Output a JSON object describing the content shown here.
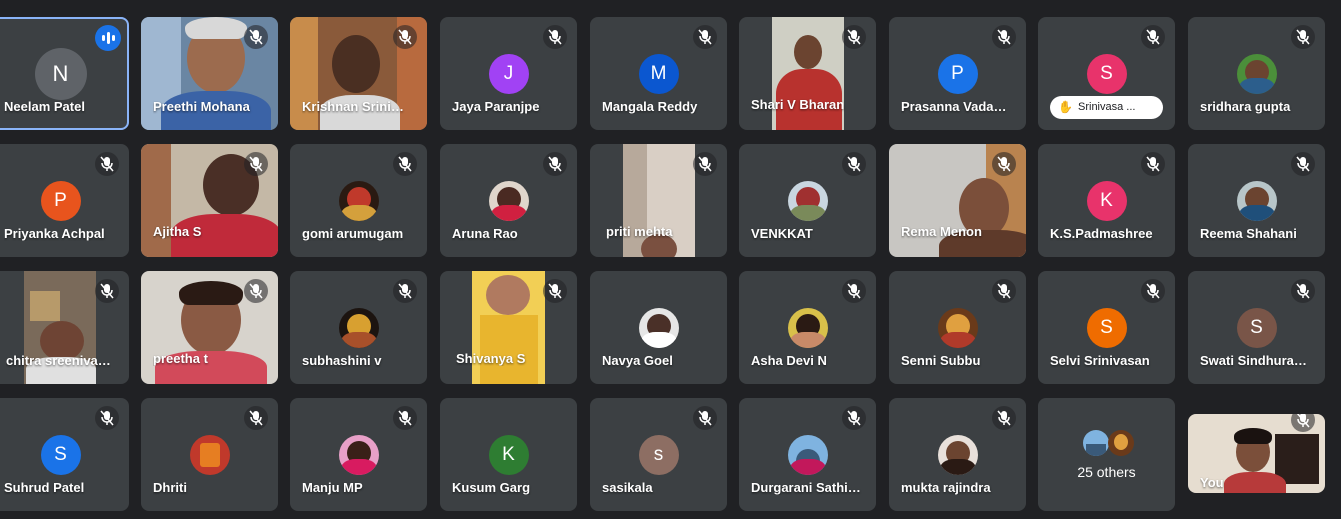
{
  "participants": [
    {
      "name": "Neelam Patel",
      "initial": "N",
      "speaking": true
    },
    {
      "name": "Preethi Mohana"
    },
    {
      "name": "Krishnan Srinivasan"
    },
    {
      "name": "Jaya Paranjpe",
      "initial": "J"
    },
    {
      "name": "Mangala Reddy",
      "initial": "M"
    },
    {
      "name": "Shari V Bharan"
    },
    {
      "name": "Prasanna Vadakkepat",
      "initial": "P"
    },
    {
      "name": "",
      "initial": "S",
      "hand_raised_label": "Srinivasa ..."
    },
    {
      "name": "sridhara gupta"
    },
    {
      "name": "Priyanka Achpal",
      "initial": "P"
    },
    {
      "name": "Ajitha S"
    },
    {
      "name": "gomi arumugam"
    },
    {
      "name": "Aruna Rao"
    },
    {
      "name": "priti mehta"
    },
    {
      "name": "VENKKAT"
    },
    {
      "name": "Rema Menon"
    },
    {
      "name": "K.S.Padmashree",
      "initial": "K"
    },
    {
      "name": "Reema Shahani"
    },
    {
      "name": "chitra sreenivasan"
    },
    {
      "name": "preetha t"
    },
    {
      "name": "subhashini v"
    },
    {
      "name": "Shivanya S"
    },
    {
      "name": "Navya Goel"
    },
    {
      "name": "Asha Devi N"
    },
    {
      "name": "Senni Subbu"
    },
    {
      "name": "Selvi Srinivasan",
      "initial": "S"
    },
    {
      "name": "Swati Sindhurakar",
      "initial": "S"
    },
    {
      "name": "Suhrud Patel",
      "initial": "S"
    },
    {
      "name": "Dhriti"
    },
    {
      "name": "Manju MP"
    },
    {
      "name": "Kusum Garg",
      "initial": "K"
    },
    {
      "name": "sasikala",
      "initial": "s"
    },
    {
      "name": "Durgarani Sathish"
    },
    {
      "name": "mukta rajindra"
    },
    {
      "name": "25 others"
    },
    {
      "name": "You"
    }
  ],
  "colors": {
    "background": "#202124",
    "tile": "#3c4043",
    "active_border": "#8ab4f8",
    "speaking_indicator": "#1a73e8",
    "avatar_N": "#5f6368",
    "avatar_J": "#a142f4",
    "avatar_M": "#0b57d0",
    "avatar_P_blue": "#1a73e8",
    "avatar_S_pink": "#e8336b",
    "avatar_P_orange": "#e8541d",
    "avatar_K_pink": "#e8336b",
    "avatar_S_orange": "#ef6c00",
    "avatar_S_brown": "#795548",
    "avatar_S_blue": "#1a73e8",
    "avatar_K_green": "#2e7d32",
    "avatar_s_brown": "#8d6e63"
  },
  "icons": {
    "muted": "mic-off-icon",
    "speaking": "audio-wave-icon",
    "hand": "raised-hand-icon"
  }
}
